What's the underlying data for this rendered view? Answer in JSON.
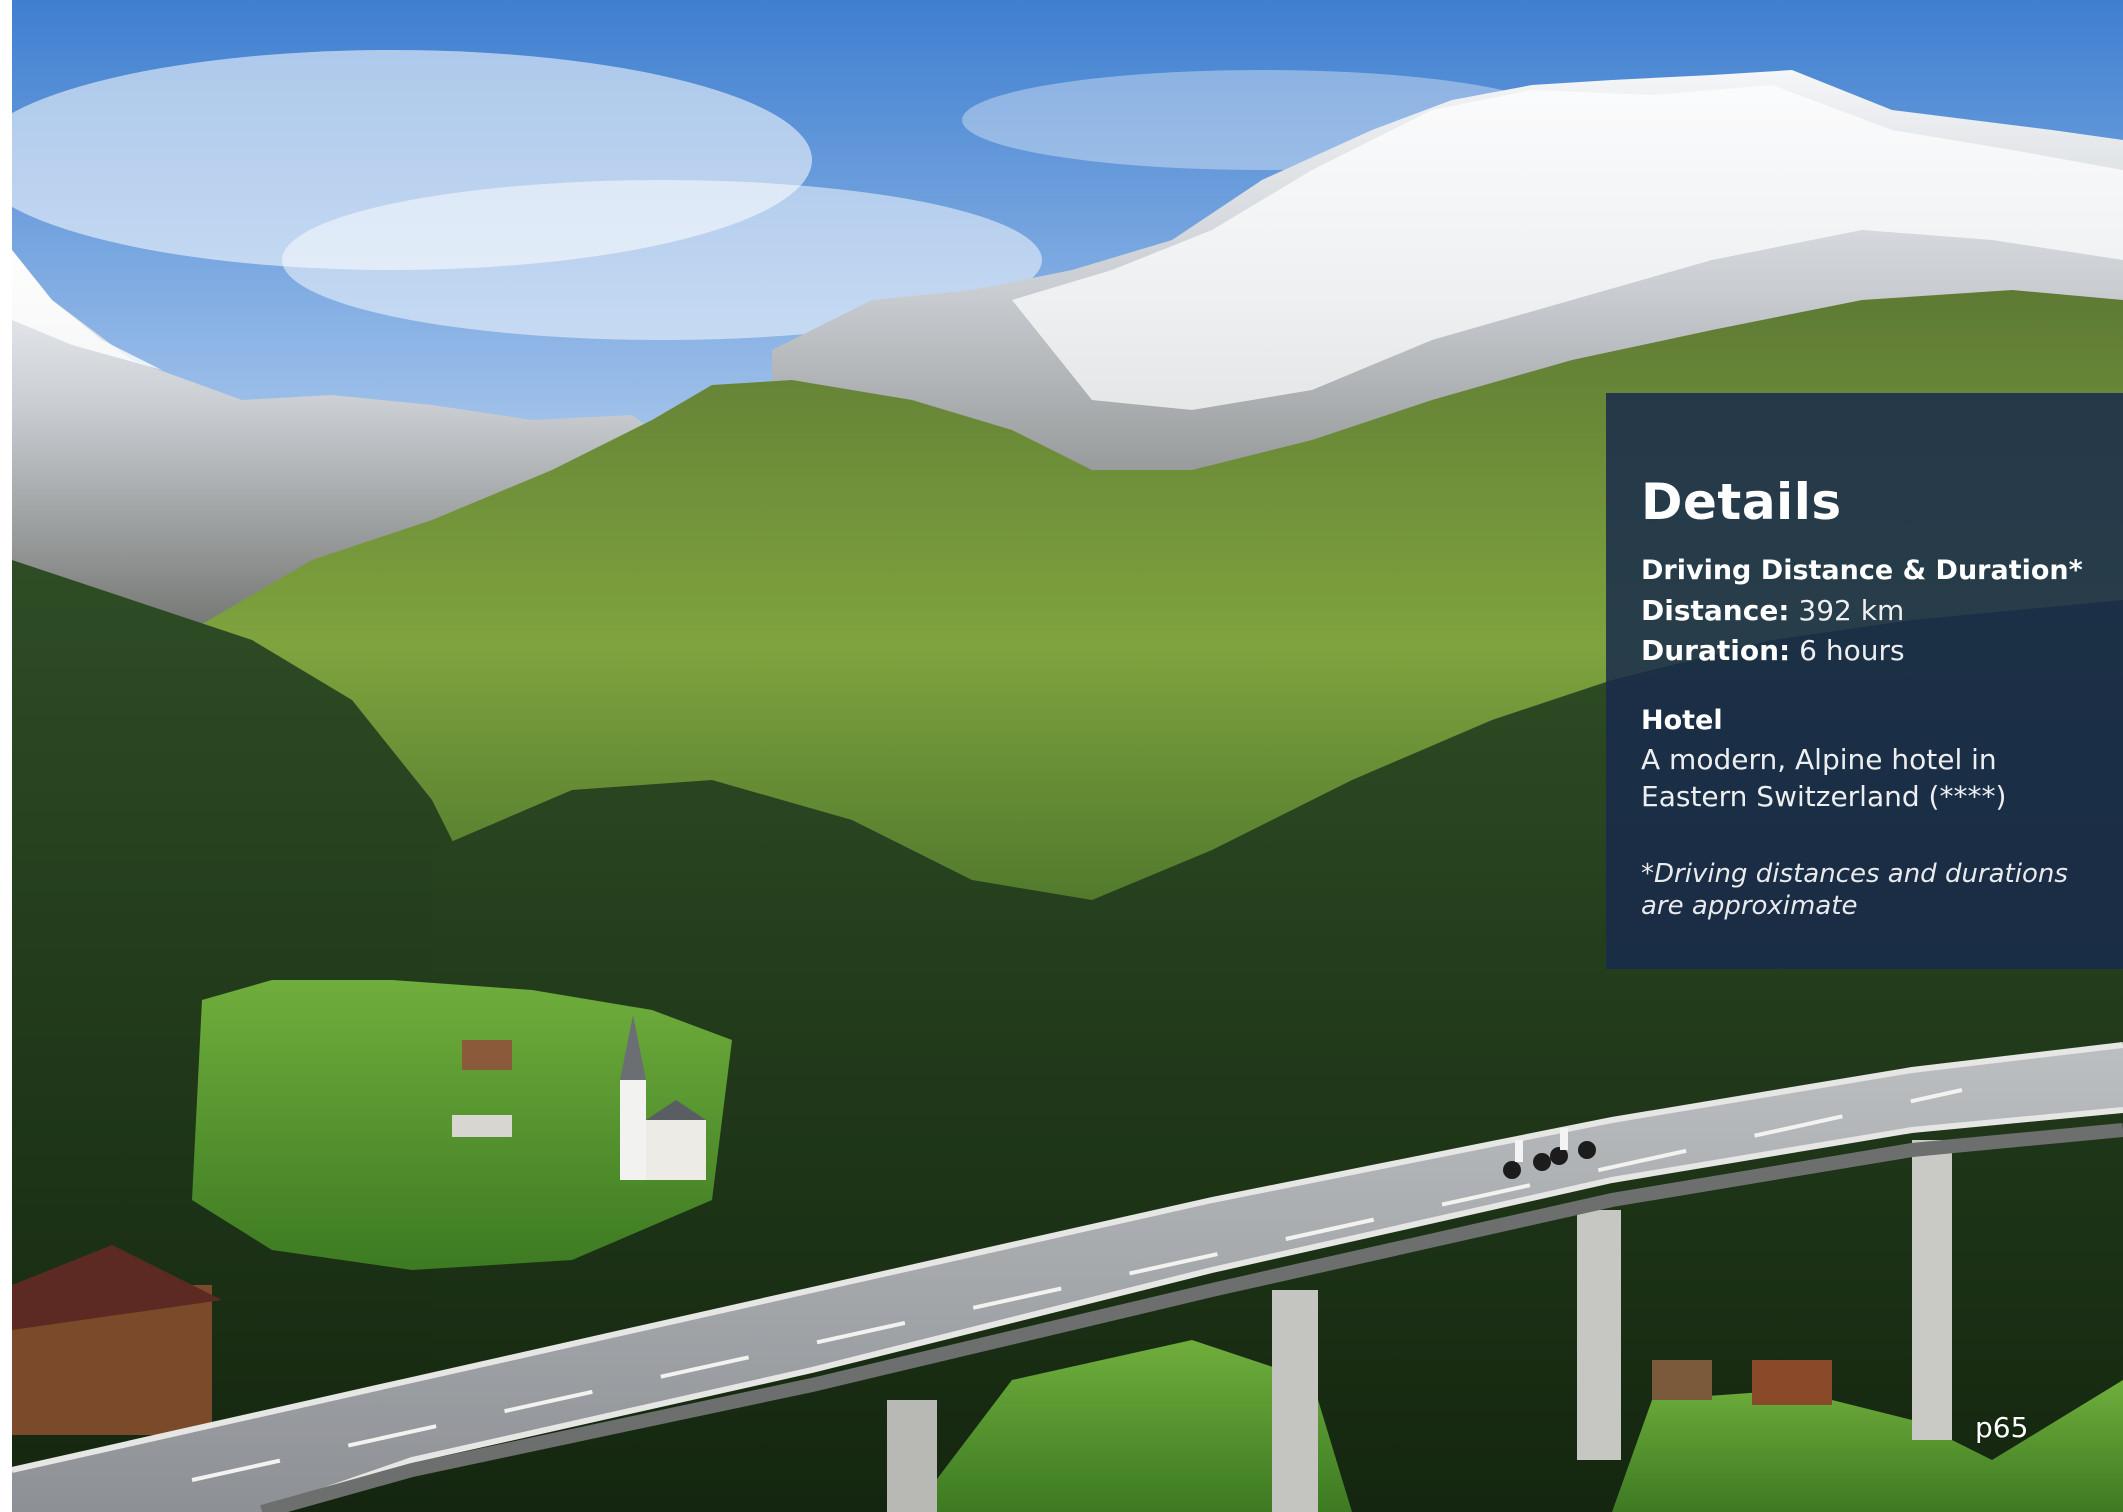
{
  "details": {
    "title": "Details",
    "driving_heading": "Driving Distance & Duration*",
    "distance_label": "Distance:",
    "distance_value": "392 km",
    "duration_label": "Duration:",
    "duration_value": "6 hours",
    "hotel_heading": "Hotel",
    "hotel_line1": "A modern, Alpine hotel in",
    "hotel_line2": "Eastern Switzerland (****)",
    "footnote_line1": "*Driving distances and durations",
    "footnote_line2": "are approximate"
  },
  "page_number": "p65",
  "colors": {
    "panel": "#182a4c",
    "sky": "#4a86d4",
    "grass": "#6fa03a",
    "forest": "#1f3a1c"
  }
}
